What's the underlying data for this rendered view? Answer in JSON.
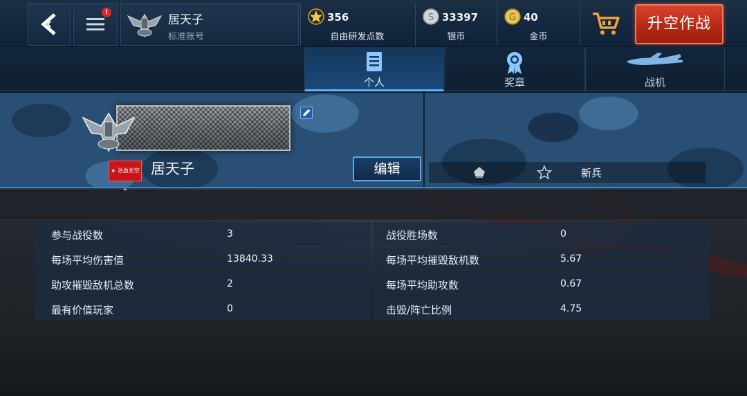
{
  "header": {
    "back_icon": "back-chevron-icon",
    "menu_icon": "menu-icon",
    "menu_badge": "!",
    "profile": {
      "name": "居天子",
      "account_type": "标准账号",
      "emblem_icon": "eagle-emblem-icon"
    },
    "resources": [
      {
        "icon": "star-icon",
        "value": "356",
        "label": "自由研发点数"
      },
      {
        "icon": "silver-coin-icon",
        "value": "33397",
        "label": "银币"
      },
      {
        "icon": "gold-coin-icon",
        "value": "40",
        "label": "金币"
      }
    ],
    "cart_icon": "cart-icon",
    "launch_label": "升空作战"
  },
  "tabs": [
    {
      "label": "个人",
      "icon": "document-icon",
      "active": true
    },
    {
      "label": "奖章",
      "icon": "medal-icon",
      "active": false
    },
    {
      "label": "战机",
      "icon": "aircraft-icon",
      "active": false
    }
  ],
  "profile_banner": {
    "player_name": "居天子",
    "rank_badge_text": "★ 浴血长空 ★",
    "edit_label": "编辑",
    "rank_title": "新兵"
  },
  "stats": {
    "rows": [
      {
        "left_label": "参与战役数",
        "left_value": "3",
        "right_label": "战役胜场数",
        "right_value": "0"
      },
      {
        "left_label": "每场平均伤害值",
        "left_value": "13840.33",
        "right_label": "每场平均摧毁敌机数",
        "right_value": "5.67"
      },
      {
        "left_label": "助攻摧毁敌机总数",
        "left_value": "2",
        "right_label": "每场平均助攻数",
        "right_value": "0.67"
      },
      {
        "left_label": "最有价值玩家",
        "left_value": "0",
        "right_label": "击毁/阵亡比例",
        "right_value": "4.75"
      }
    ]
  },
  "colors": {
    "accent": "#5fb4ff",
    "launch": "#c0301c",
    "panel": "#1c2c40"
  }
}
